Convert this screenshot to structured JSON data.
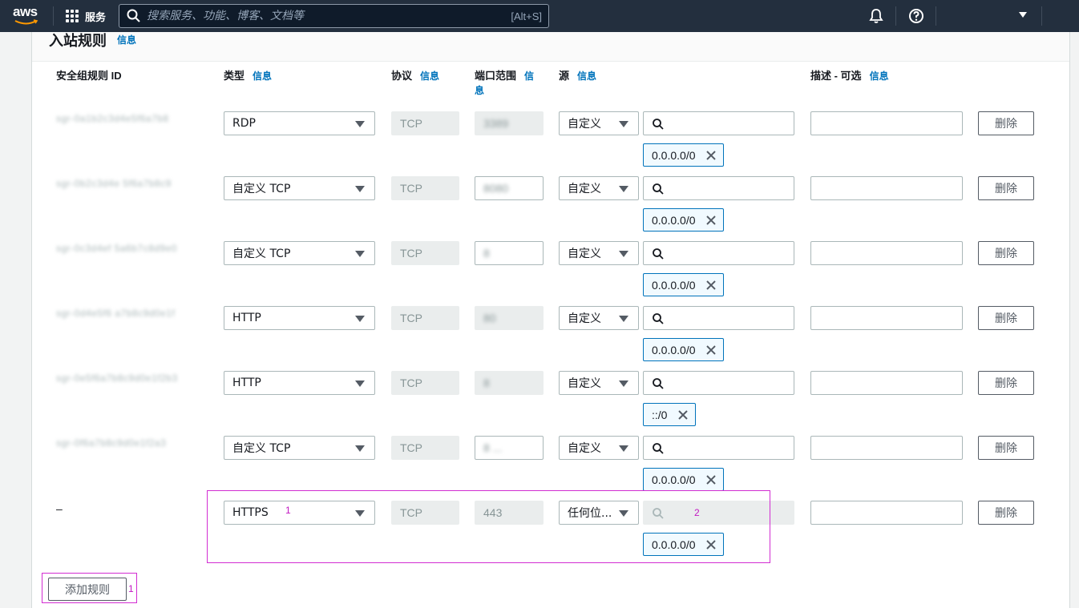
{
  "topnav": {
    "logo": "aws",
    "services_label": "服务",
    "search_placeholder": "搜索服务、功能、博客、文档等",
    "search_shortcut": "[Alt+S]",
    "bell_icon": "bell-icon",
    "help_icon": "help-icon"
  },
  "panel": {
    "title": "入站规则",
    "title_info": "信息"
  },
  "columns": {
    "rule_id": "安全组规则 ID",
    "type": "类型",
    "type_info": "信息",
    "protocol": "协议",
    "protocol_info": "信息",
    "port_range": "端口范围",
    "port_range_info": "信",
    "port_range_info_2": "息",
    "source": "源",
    "source_info": "信息",
    "description": "描述 - 可选",
    "description_info": "信息"
  },
  "rules": [
    {
      "id": "sgr-0a1b2c3d4e5f6a7b8",
      "type": "RDP",
      "protocol": "TCP",
      "port": "3389",
      "source_type": "自定义",
      "cidr": "0.0.0.0/0",
      "delete": "删除"
    },
    {
      "id": "sgr-0b2c3d4e 5f6a7b8c9",
      "type": "自定义 TCP",
      "protocol": "TCP",
      "port": "8080",
      "source_type": "自定义",
      "cidr": "0.0.0.0/0",
      "delete": "删除"
    },
    {
      "id": "sgr-0c3d4ef 5a6b7c8d9e0",
      "type": "自定义 TCP",
      "protocol": "TCP",
      "port": "8",
      "source_type": "自定义",
      "cidr": "0.0.0.0/0",
      "delete": "删除"
    },
    {
      "id": "sgr-0d4e5f6 a7b8c9d0e1f",
      "type": "HTTP",
      "protocol": "TCP",
      "port": "80",
      "source_type": "自定义",
      "cidr": "0.0.0.0/0",
      "delete": "删除"
    },
    {
      "id": "sgr-0e5f6a7b8c9d0e1f2b3",
      "type": "HTTP",
      "protocol": "TCP",
      "port": "8",
      "source_type": "自定义",
      "cidr": "::/0",
      "delete": "删除"
    },
    {
      "id": "sgr-0f6a7b8c9d0e1f2a3",
      "type": "自定义 TCP",
      "protocol": "TCP",
      "port": "8 ...",
      "source_type": "自定义",
      "cidr": "0.0.0.0/0",
      "delete": "删除"
    },
    {
      "id": "–",
      "type": "HTTPS",
      "protocol": "TCP",
      "port": "443",
      "source_type": "任何位...",
      "cidr": "0.0.0.0/0",
      "delete": "删除"
    }
  ],
  "add_rule_label": "添加规则",
  "annotations": {
    "a1": "1",
    "a2": "2",
    "a3": "1"
  },
  "colors": {
    "nav_bg": "#232f3e",
    "link": "#0073bb",
    "annotation": "#d22dd2"
  }
}
